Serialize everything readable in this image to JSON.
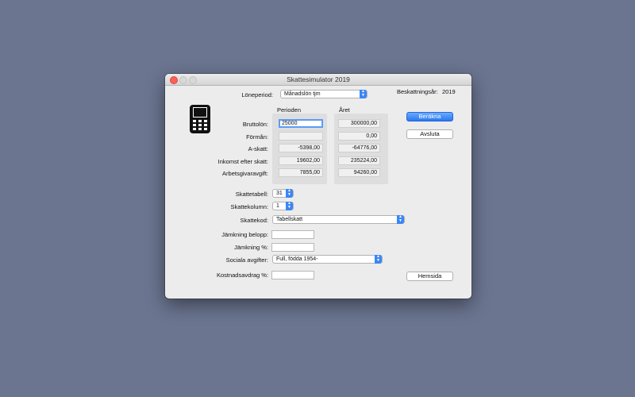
{
  "window": {
    "title": "Skattesimulator 2019"
  },
  "header": {
    "loneperiod_label": "Löneperiod:",
    "loneperiod_value": "Månadslön tjm",
    "beskattningsar_label": "Beskattningsår:",
    "beskattningsar_value": "2019"
  },
  "columns": {
    "period": "Perioden",
    "year": "Året"
  },
  "rows": [
    {
      "label": "Bruttolön:",
      "period": "25000",
      "year": "300000,00"
    },
    {
      "label": "Förmån:",
      "period": "",
      "year": "0,00"
    },
    {
      "label": "A-skatt:",
      "period": "-5398,00",
      "year": "-64776,00"
    },
    {
      "label": "Inkomst efter skatt:",
      "period": "19602,00",
      "year": "235224,00"
    },
    {
      "label": "Arbetsgivaravgift:",
      "period": "7855,00",
      "year": "94260,00"
    }
  ],
  "settings": {
    "skattetabell_label": "Skattetabell:",
    "skattetabell_value": "31",
    "skattekolumn_label": "Skattekolumn:",
    "skattekolumn_value": "1",
    "skattekod_label": "Skattekod:",
    "skattekod_value": "Tabellskatt",
    "jamkning_belopp_label": "Jämkning belopp:",
    "jamkning_belopp_value": "",
    "jamkning_pct_label": "Jämkning %:",
    "jamkning_pct_value": "",
    "sociala_label": "Sociala avgifter:",
    "sociala_value": "Full, födda 1954-",
    "kostnadsavdrag_label": "Kostnadsavdrag %:",
    "kostnadsavdrag_value": ""
  },
  "buttons": {
    "berakna": "Beräkna",
    "avsluta": "Avsluta",
    "hemsida": "Hemsida"
  },
  "icons": {
    "close": "close-icon",
    "minimize": "minimize-icon",
    "zoom": "zoom-icon",
    "app": "mobile-phone-icon",
    "popup": "chevron-updown-icon"
  },
  "colors": {
    "desktop": "#6b7590",
    "accent": "#2a78f0",
    "close": "#fc5f57"
  }
}
